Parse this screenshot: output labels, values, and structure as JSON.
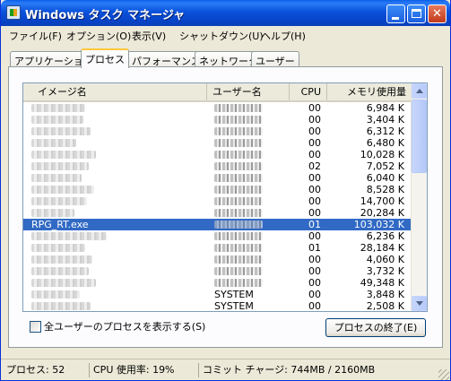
{
  "window": {
    "title": "Windows タスク マネージャ"
  },
  "titlebar_buttons": {
    "minimize_icon": "minimize-icon",
    "maximize_icon": "maximize-icon",
    "close_glyph": "✕"
  },
  "menu": [
    "ファイル(F)",
    "オプション(O)",
    "表示(V)",
    "シャットダウン(U)",
    "ヘルプ(H)"
  ],
  "tabs": [
    "アプリケーション",
    "プロセス",
    "パフォーマンス",
    "ネットワーク",
    "ユーザー"
  ],
  "active_tab": "プロセス",
  "columns": {
    "image": "イメージ名",
    "user": "ユーザー名",
    "cpu": "CPU",
    "mem": "メモリ使用量"
  },
  "processes": [
    {
      "image": "",
      "user": "",
      "cpu": "00",
      "mem": "6,984 K"
    },
    {
      "image": "",
      "user": "",
      "cpu": "00",
      "mem": "3,404 K"
    },
    {
      "image": "",
      "user": "",
      "cpu": "00",
      "mem": "6,312 K"
    },
    {
      "image": "",
      "user": "",
      "cpu": "00",
      "mem": "6,480 K"
    },
    {
      "image": "",
      "user": "",
      "cpu": "00",
      "mem": "10,028 K"
    },
    {
      "image": "",
      "user": "",
      "cpu": "02",
      "mem": "7,052 K"
    },
    {
      "image": "",
      "user": "",
      "cpu": "00",
      "mem": "6,040 K"
    },
    {
      "image": "",
      "user": "",
      "cpu": "00",
      "mem": "8,528 K"
    },
    {
      "image": "",
      "user": "",
      "cpu": "00",
      "mem": "14,700 K"
    },
    {
      "image": "",
      "user": "",
      "cpu": "00",
      "mem": "20,284 K"
    },
    {
      "image": "RPG_RT.exe",
      "user": "",
      "cpu": "01",
      "mem": "103,032 K",
      "selected": true
    },
    {
      "image": "",
      "user": "",
      "cpu": "00",
      "mem": "6,236 K"
    },
    {
      "image": "",
      "user": "",
      "cpu": "01",
      "mem": "28,184 K"
    },
    {
      "image": "",
      "user": "",
      "cpu": "00",
      "mem": "4,060 K"
    },
    {
      "image": "",
      "user": "",
      "cpu": "00",
      "mem": "3,732 K"
    },
    {
      "image": "",
      "user": "",
      "cpu": "00",
      "mem": "49,348 K"
    },
    {
      "image": "",
      "user": "SYSTEM",
      "cpu": "00",
      "mem": "3,848 K"
    },
    {
      "image": "",
      "user": "SYSTEM",
      "cpu": "00",
      "mem": "2,508 K"
    }
  ],
  "show_all_users": {
    "label": "全ユーザーのプロセスを表示する(S)",
    "checked": false
  },
  "end_process_button": "プロセスの終了(E)",
  "status": {
    "processes": "プロセス: 52",
    "cpu": "CPU 使用率: 19%",
    "commit": "コミット チャージ: 744MB / 2160MB"
  }
}
